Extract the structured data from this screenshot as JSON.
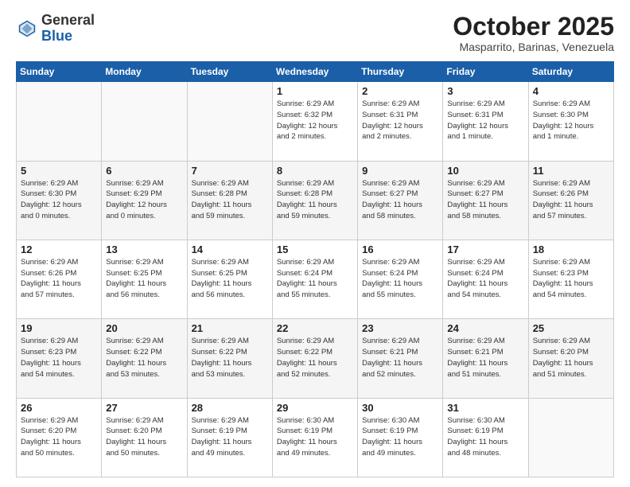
{
  "header": {
    "logo_general": "General",
    "logo_blue": "Blue",
    "month": "October 2025",
    "location": "Masparrito, Barinas, Venezuela"
  },
  "days_of_week": [
    "Sunday",
    "Monday",
    "Tuesday",
    "Wednesday",
    "Thursday",
    "Friday",
    "Saturday"
  ],
  "weeks": [
    [
      {
        "day": "",
        "info": ""
      },
      {
        "day": "",
        "info": ""
      },
      {
        "day": "",
        "info": ""
      },
      {
        "day": "1",
        "info": "Sunrise: 6:29 AM\nSunset: 6:32 PM\nDaylight: 12 hours\nand 2 minutes."
      },
      {
        "day": "2",
        "info": "Sunrise: 6:29 AM\nSunset: 6:31 PM\nDaylight: 12 hours\nand 2 minutes."
      },
      {
        "day": "3",
        "info": "Sunrise: 6:29 AM\nSunset: 6:31 PM\nDaylight: 12 hours\nand 1 minute."
      },
      {
        "day": "4",
        "info": "Sunrise: 6:29 AM\nSunset: 6:30 PM\nDaylight: 12 hours\nand 1 minute."
      }
    ],
    [
      {
        "day": "5",
        "info": "Sunrise: 6:29 AM\nSunset: 6:30 PM\nDaylight: 12 hours\nand 0 minutes."
      },
      {
        "day": "6",
        "info": "Sunrise: 6:29 AM\nSunset: 6:29 PM\nDaylight: 12 hours\nand 0 minutes."
      },
      {
        "day": "7",
        "info": "Sunrise: 6:29 AM\nSunset: 6:28 PM\nDaylight: 11 hours\nand 59 minutes."
      },
      {
        "day": "8",
        "info": "Sunrise: 6:29 AM\nSunset: 6:28 PM\nDaylight: 11 hours\nand 59 minutes."
      },
      {
        "day": "9",
        "info": "Sunrise: 6:29 AM\nSunset: 6:27 PM\nDaylight: 11 hours\nand 58 minutes."
      },
      {
        "day": "10",
        "info": "Sunrise: 6:29 AM\nSunset: 6:27 PM\nDaylight: 11 hours\nand 58 minutes."
      },
      {
        "day": "11",
        "info": "Sunrise: 6:29 AM\nSunset: 6:26 PM\nDaylight: 11 hours\nand 57 minutes."
      }
    ],
    [
      {
        "day": "12",
        "info": "Sunrise: 6:29 AM\nSunset: 6:26 PM\nDaylight: 11 hours\nand 57 minutes."
      },
      {
        "day": "13",
        "info": "Sunrise: 6:29 AM\nSunset: 6:25 PM\nDaylight: 11 hours\nand 56 minutes."
      },
      {
        "day": "14",
        "info": "Sunrise: 6:29 AM\nSunset: 6:25 PM\nDaylight: 11 hours\nand 56 minutes."
      },
      {
        "day": "15",
        "info": "Sunrise: 6:29 AM\nSunset: 6:24 PM\nDaylight: 11 hours\nand 55 minutes."
      },
      {
        "day": "16",
        "info": "Sunrise: 6:29 AM\nSunset: 6:24 PM\nDaylight: 11 hours\nand 55 minutes."
      },
      {
        "day": "17",
        "info": "Sunrise: 6:29 AM\nSunset: 6:24 PM\nDaylight: 11 hours\nand 54 minutes."
      },
      {
        "day": "18",
        "info": "Sunrise: 6:29 AM\nSunset: 6:23 PM\nDaylight: 11 hours\nand 54 minutes."
      }
    ],
    [
      {
        "day": "19",
        "info": "Sunrise: 6:29 AM\nSunset: 6:23 PM\nDaylight: 11 hours\nand 54 minutes."
      },
      {
        "day": "20",
        "info": "Sunrise: 6:29 AM\nSunset: 6:22 PM\nDaylight: 11 hours\nand 53 minutes."
      },
      {
        "day": "21",
        "info": "Sunrise: 6:29 AM\nSunset: 6:22 PM\nDaylight: 11 hours\nand 53 minutes."
      },
      {
        "day": "22",
        "info": "Sunrise: 6:29 AM\nSunset: 6:22 PM\nDaylight: 11 hours\nand 52 minutes."
      },
      {
        "day": "23",
        "info": "Sunrise: 6:29 AM\nSunset: 6:21 PM\nDaylight: 11 hours\nand 52 minutes."
      },
      {
        "day": "24",
        "info": "Sunrise: 6:29 AM\nSunset: 6:21 PM\nDaylight: 11 hours\nand 51 minutes."
      },
      {
        "day": "25",
        "info": "Sunrise: 6:29 AM\nSunset: 6:20 PM\nDaylight: 11 hours\nand 51 minutes."
      }
    ],
    [
      {
        "day": "26",
        "info": "Sunrise: 6:29 AM\nSunset: 6:20 PM\nDaylight: 11 hours\nand 50 minutes."
      },
      {
        "day": "27",
        "info": "Sunrise: 6:29 AM\nSunset: 6:20 PM\nDaylight: 11 hours\nand 50 minutes."
      },
      {
        "day": "28",
        "info": "Sunrise: 6:29 AM\nSunset: 6:19 PM\nDaylight: 11 hours\nand 49 minutes."
      },
      {
        "day": "29",
        "info": "Sunrise: 6:30 AM\nSunset: 6:19 PM\nDaylight: 11 hours\nand 49 minutes."
      },
      {
        "day": "30",
        "info": "Sunrise: 6:30 AM\nSunset: 6:19 PM\nDaylight: 11 hours\nand 49 minutes."
      },
      {
        "day": "31",
        "info": "Sunrise: 6:30 AM\nSunset: 6:19 PM\nDaylight: 11 hours\nand 48 minutes."
      },
      {
        "day": "",
        "info": ""
      }
    ]
  ]
}
